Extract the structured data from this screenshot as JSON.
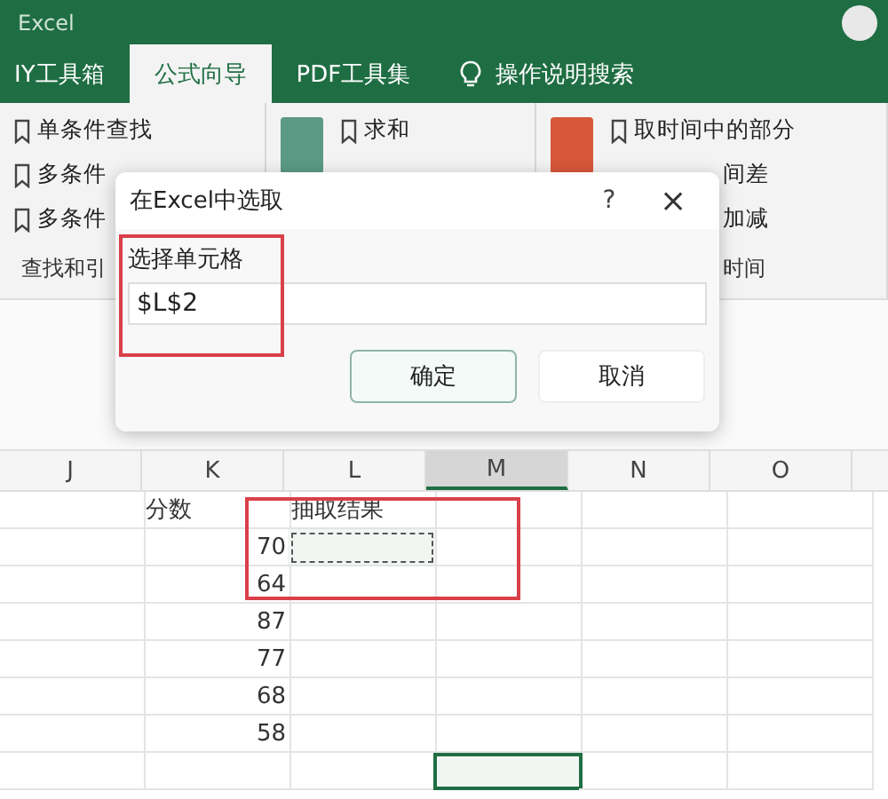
{
  "app_title": "Excel",
  "tabs": [
    {
      "label": "IY工具箱",
      "selected": false
    },
    {
      "label": "公式向导",
      "selected": true
    },
    {
      "label": "PDF工具集",
      "selected": false
    }
  ],
  "search": {
    "label": "操作说明搜索"
  },
  "ribbon_groups": [
    {
      "kind": "list",
      "label": "查找和引",
      "items": [
        {
          "text": "单条件查找",
          "kind": "full"
        },
        {
          "text": "多条件",
          "kind": "full"
        },
        {
          "text": "多条件",
          "kind": "full"
        }
      ]
    },
    {
      "kind": "button",
      "items": [
        {
          "text": "求和",
          "kind": "full"
        }
      ]
    },
    {
      "kind": "button",
      "label": "时间",
      "items": [
        {
          "text": "取时间中的部分",
          "kind": "full"
        },
        {
          "text": "间差",
          "kind": "covered"
        },
        {
          "text": "加减",
          "kind": "covered"
        }
      ]
    }
  ],
  "dialog": {
    "title": "在Excel中选取",
    "help": "?",
    "close": "×",
    "field_label": "选择单元格",
    "value": "$L$2",
    "buttons": [
      {
        "label": "确定",
        "default": true
      },
      {
        "label": "取消",
        "default": false
      }
    ]
  },
  "sheet": {
    "columns": [
      {
        "label": "J",
        "selected": false
      },
      {
        "label": "K",
        "selected": false
      },
      {
        "label": "L",
        "selected": false
      },
      {
        "label": "M",
        "selected": true
      },
      {
        "label": "N",
        "selected": false
      },
      {
        "label": "O",
        "selected": false
      }
    ],
    "rows": [
      [
        {
          "selected": false
        },
        {
          "text": "分数",
          "selected": false
        },
        {
          "text": "抽取结果",
          "selected": false
        },
        {
          "selected": false
        },
        {
          "selected": false
        },
        {
          "selected": false
        }
      ],
      [
        {
          "selected": false
        },
        {
          "text": "70",
          "kind": "number",
          "selected": false
        },
        {
          "copied": true,
          "selected": false
        },
        {
          "selected": false
        },
        {
          "selected": false
        },
        {
          "selected": false
        }
      ],
      [
        {
          "selected": false
        },
        {
          "text": "64",
          "kind": "number",
          "selected": false
        },
        {
          "selected": false
        },
        {
          "selected": false
        },
        {
          "selected": false
        },
        {
          "selected": false
        }
      ],
      [
        {
          "selected": false
        },
        {
          "text": "87",
          "kind": "number",
          "selected": false
        },
        {
          "selected": false
        },
        {
          "selected": false
        },
        {
          "selected": false
        },
        {
          "selected": false
        }
      ],
      [
        {
          "selected": false
        },
        {
          "text": "77",
          "kind": "number",
          "selected": false
        },
        {
          "selected": false
        },
        {
          "selected": false
        },
        {
          "selected": false
        },
        {
          "selected": false
        }
      ],
      [
        {
          "selected": false
        },
        {
          "text": "68",
          "kind": "number",
          "selected": false
        },
        {
          "selected": false
        },
        {
          "selected": false
        },
        {
          "selected": false
        },
        {
          "selected": false
        }
      ],
      [
        {
          "selected": false
        },
        {
          "text": "58",
          "kind": "number",
          "selected": false
        },
        {
          "selected": false
        },
        {
          "selected": false
        },
        {
          "selected": false
        },
        {
          "selected": false
        }
      ],
      [
        {
          "selected": false
        },
        {
          "selected": false
        },
        {
          "selected": false
        },
        {
          "selected": true
        },
        {
          "selected": false
        },
        {
          "selected": false
        }
      ]
    ]
  }
}
